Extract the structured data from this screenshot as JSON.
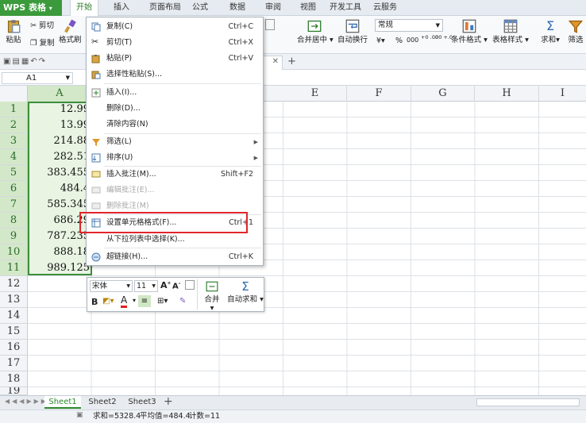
{
  "app": {
    "logo": "WPS 表格"
  },
  "menu_tabs": [
    "开始",
    "插入",
    "页面布局",
    "公式",
    "数据",
    "审阅",
    "视图",
    "开发工具",
    "云服务"
  ],
  "ribbon": {
    "paste": "粘贴",
    "cut": "剪切",
    "copy": "复制",
    "format_painter": "格式刷",
    "merge_center": "合并居中",
    "wrap_text": "自动换行",
    "number_format": "常规",
    "cond_format": "条件格式",
    "table_style": "表格样式",
    "sum": "求和",
    "filter": "筛选",
    "percent": "%",
    "comma": "000",
    "inc_decimal": "+0 .00",
    "dec_decimal": ".00 +.0"
  },
  "new_tab": "+",
  "namebox": "A1",
  "columns": [
    "A",
    "E",
    "F",
    "G",
    "H",
    "I"
  ],
  "rows": [
    "1",
    "2",
    "3",
    "4",
    "5",
    "6",
    "7",
    "8",
    "9",
    "10",
    "11",
    "12",
    "13",
    "14",
    "15",
    "16",
    "17",
    "18",
    "19"
  ],
  "col_a_values": [
    "12.99",
    "13.99",
    "214.88",
    "282.51",
    "383.455",
    "484.4",
    "585.345",
    "686.29",
    "787.235",
    "888.18",
    "989.125"
  ],
  "context_menu": {
    "copy": {
      "label": "复制(C)",
      "shortcut": "Ctrl+C"
    },
    "cut": {
      "label": "剪切(T)",
      "shortcut": "Ctrl+X"
    },
    "paste": {
      "label": "粘贴(P)",
      "shortcut": "Ctrl+V"
    },
    "paste_special": {
      "label": "选择性粘贴(S)..."
    },
    "insert": {
      "label": "插入(I)..."
    },
    "delete": {
      "label": "删除(D)..."
    },
    "clear": {
      "label": "清除内容(N)"
    },
    "filter": {
      "label": "筛选(L)"
    },
    "sort": {
      "label": "排序(U)"
    },
    "insert_comment": {
      "label": "插入批注(M)...",
      "shortcut": "Shift+F2"
    },
    "edit_comment": {
      "label": "编辑批注(E)..."
    },
    "delete_comment": {
      "label": "删除批注(M)"
    },
    "format_cells": {
      "label": "设置单元格格式(F)...",
      "shortcut": "Ctrl+1"
    },
    "pick_from_list": {
      "label": "从下拉列表中选择(K)..."
    },
    "hyperlink": {
      "label": "超链接(H)...",
      "shortcut": "Ctrl+K"
    }
  },
  "mini_toolbar": {
    "font": "宋体",
    "size": "11",
    "bold": "B",
    "merge": "合并",
    "autosum": "自动求和"
  },
  "sheets": [
    "Sheet1",
    "Sheet2",
    "Sheet3"
  ],
  "add_sheet": "+",
  "status": {
    "sum": "求和=5328.4",
    "avg": "平均值=484.4",
    "count": "计数=11"
  }
}
